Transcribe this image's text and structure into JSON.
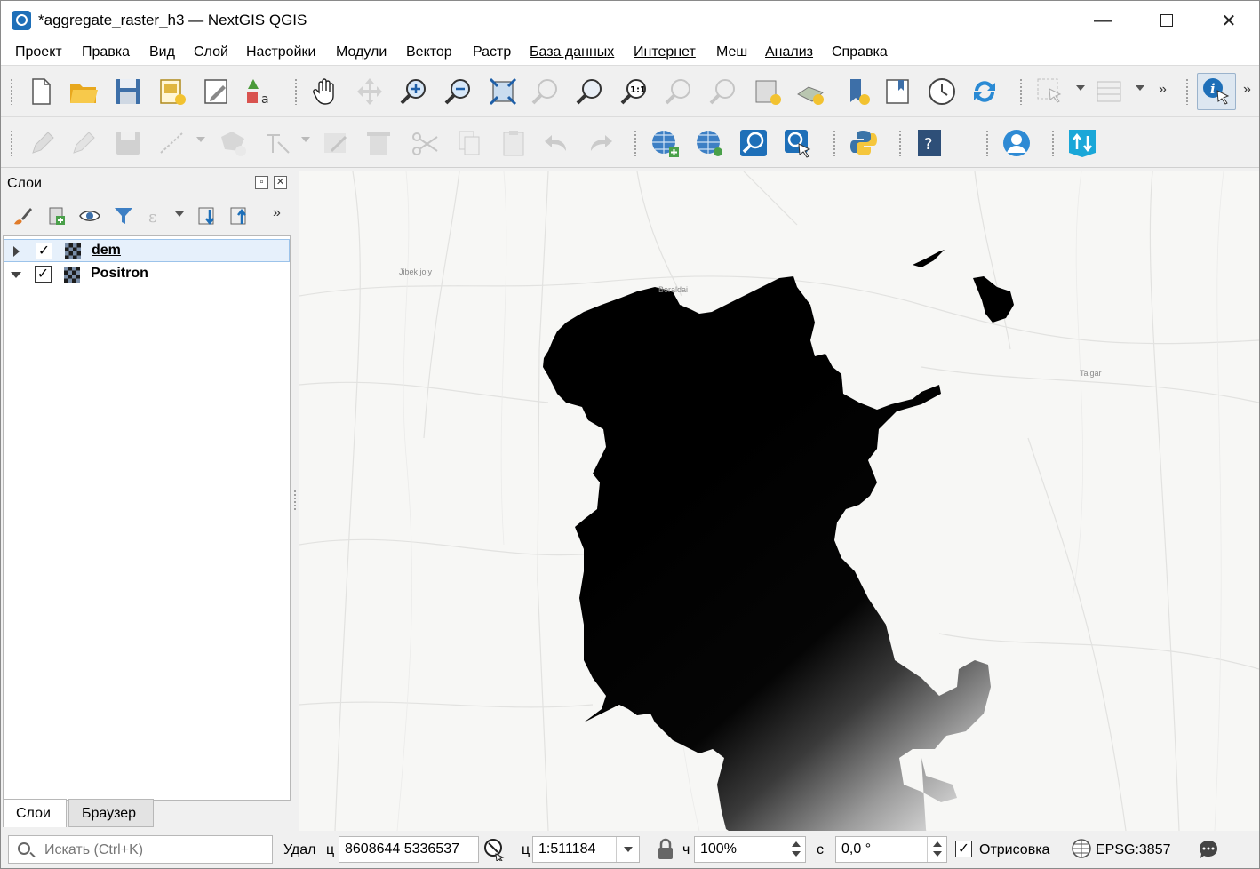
{
  "window": {
    "title": "*aggregate_raster_h3 — NextGIS QGIS",
    "minimize": "—",
    "close": "✕"
  },
  "menu": [
    "Проект",
    "Правка",
    "Вид",
    "Слой",
    "Настройки",
    "Модули",
    "Вектор",
    "Растр",
    "База данных",
    "Интернет",
    "Меш",
    "Анализ",
    "Справка"
  ],
  "layers_panel": {
    "title": "Слои",
    "layers": [
      {
        "name": "dem",
        "checked": true,
        "expanded": false,
        "selected": true
      },
      {
        "name": "Positron",
        "checked": true,
        "expanded": true,
        "selected": false
      }
    ],
    "tabs": [
      "Слои",
      "Браузер"
    ]
  },
  "map": {
    "labels": [
      "Jibek joly",
      "Boraldai",
      "Talgar"
    ]
  },
  "statusbar": {
    "search_placeholder": "Искать (Ctrl+K)",
    "coord_label": "Удал",
    "coord_prefix": "ц",
    "coordinates": "8608644  5336537",
    "scale_prefix": "ц",
    "scale": "1:511184",
    "magnifier_prefix": "ч",
    "magnifier": "100%",
    "rotation_prefix": "с",
    "rotation": "0,0 °",
    "render_label": "Отрисовка",
    "render_checked": true,
    "crs": "EPSG:3857"
  },
  "colors": {
    "accent": "#1e6fb8",
    "map_background": "#f7f7f5",
    "raster_dark": "#000000",
    "raster_light": "#f2f2f2"
  },
  "icons": [
    "new-project-icon",
    "open-project-icon",
    "save-project-icon",
    "new-print-layout-icon",
    "layout-manager-icon",
    "style-manager-icon",
    "pan-icon",
    "pan-to-selection-icon",
    "zoom-in-icon",
    "zoom-out-icon",
    "zoom-full-icon",
    "zoom-to-selection-icon",
    "zoom-to-layer-icon",
    "zoom-native-icon",
    "zoom-last-icon",
    "zoom-next-icon",
    "new-bookmark-icon",
    "show-bookmarks-icon",
    "temporal-controller-icon",
    "refresh-icon",
    "select-features-icon",
    "attribute-table-icon",
    "identify-icon"
  ]
}
